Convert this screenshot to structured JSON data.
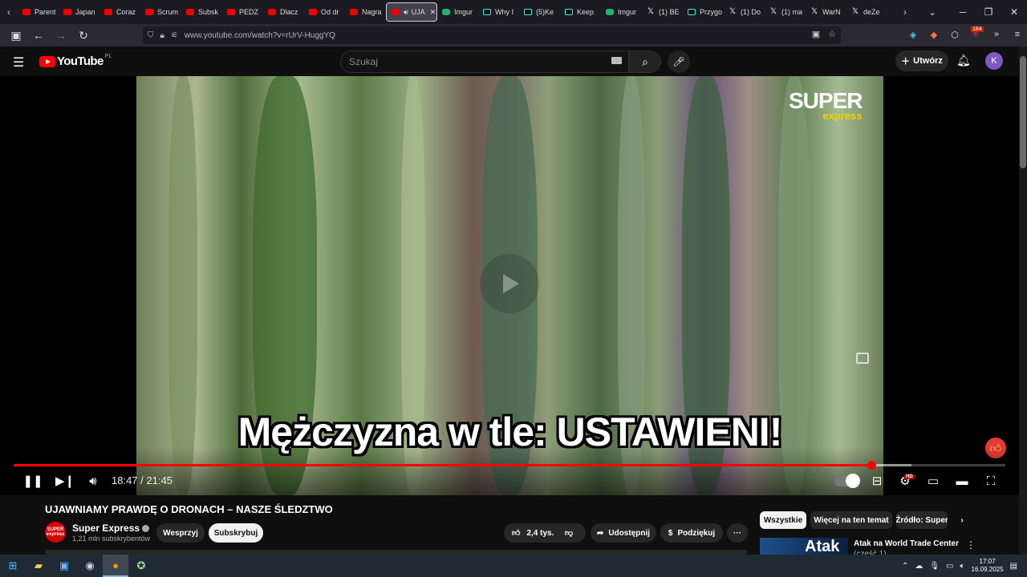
{
  "browser": {
    "tabs": [
      {
        "label": "Parent",
        "icon": "youtube-icon",
        "kind": "yt"
      },
      {
        "label": "Japan",
        "icon": "youtube-icon",
        "kind": "yt"
      },
      {
        "label": "Coraz",
        "icon": "youtube-icon",
        "kind": "yt"
      },
      {
        "label": "Scrum",
        "icon": "youtube-icon",
        "kind": "yt"
      },
      {
        "label": "Subsk",
        "icon": "youtube-icon",
        "kind": "yt"
      },
      {
        "label": "PEDZ",
        "icon": "youtube-icon",
        "kind": "yt"
      },
      {
        "label": "Dlacz",
        "icon": "youtube-icon",
        "kind": "yt"
      },
      {
        "label": "Od dr",
        "icon": "youtube-icon",
        "kind": "yt"
      },
      {
        "label": "Nagra",
        "icon": "youtube-icon",
        "kind": "yt"
      },
      {
        "label": "UJA",
        "icon": "youtube-icon",
        "kind": "yt",
        "active": true
      },
      {
        "label": "Imgur",
        "icon": "imgur-icon",
        "kind": "imgur"
      },
      {
        "label": "Why I",
        "icon": "tiktok-icon",
        "kind": "tt"
      },
      {
        "label": "(5)Ke",
        "icon": "tiktok-icon",
        "kind": "tt"
      },
      {
        "label": "Keep",
        "icon": "tiktok-icon",
        "kind": "tt"
      },
      {
        "label": "Imgur",
        "icon": "imgur-icon",
        "kind": "imgur"
      },
      {
        "label": "(1) BE",
        "icon": "x-icon",
        "kind": "x"
      },
      {
        "label": "Przygo",
        "icon": "tiktok-icon",
        "kind": "tt"
      },
      {
        "label": "(1) Do",
        "icon": "x-icon",
        "kind": "x"
      },
      {
        "label": "(1) ma",
        "icon": "x-icon",
        "kind": "x"
      },
      {
        "label": "WarN",
        "icon": "x-icon",
        "kind": "x"
      },
      {
        "label": "deZe",
        "icon": "x-icon",
        "kind": "x"
      }
    ],
    "url": "www.youtube.com/watch?v=rUrV-HuggYQ",
    "extension_badge": "184"
  },
  "youtube": {
    "logo": "YouTube",
    "country": "PL",
    "search_placeholder": "Szukaj",
    "create_label": "Utwórz",
    "avatar_letter": "K"
  },
  "player": {
    "watermark_main": "SUPER",
    "watermark_sub": "express",
    "caption": "Mężczyzna w tle: USTAWIENI!",
    "time_current": "18:47",
    "time_total": "21:45",
    "time_display": "18:47 / 21:45",
    "progress_played": 0.865,
    "progress_loaded": 0.905,
    "hd_badge": "HD"
  },
  "video": {
    "title": "UJAWNIAMY PRAWDĘ O DRONACH – NASZE ŚLEDZTWO",
    "channel_name": "Super Express",
    "channel_avatar_text": "SUPER express",
    "subscribers": "1,21 mln subskrybentów",
    "support_label": "Wesprzyj",
    "subscribe_label": "Subskrybuj",
    "likes": "2,4 tys.",
    "share_label": "Udostępnij",
    "thanks_label": "Podziękuj",
    "more_label": "···"
  },
  "sidebar": {
    "filters": [
      "Wszystkie",
      "Więcej na ten temat",
      "Źródło: Super"
    ],
    "related_thumb_text": "Atak",
    "related_title": "Atak na World Trade Center",
    "related_sub": "(część 1)"
  },
  "taskbar": {
    "time": "17:07",
    "date": "16.09.2025"
  }
}
